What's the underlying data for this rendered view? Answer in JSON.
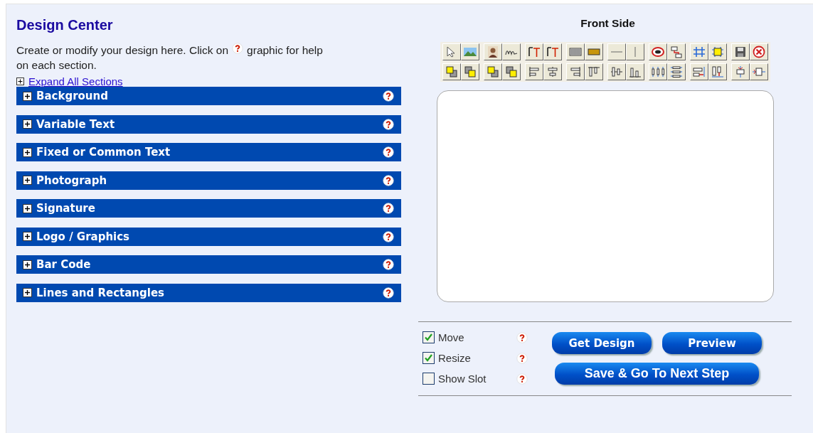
{
  "header": {
    "title": "Design Center",
    "intro_before": "Create or modify your design here. Click on",
    "intro_after": "graphic for help",
    "intro_line2": "on each section.",
    "expand_all": "Expand All Sections"
  },
  "sections": [
    {
      "label": "Background",
      "expanded": false
    },
    {
      "label": "Variable Text",
      "expanded": false
    },
    {
      "label": "Fixed or Common Text",
      "expanded": false
    },
    {
      "label": "Photograph",
      "expanded": false
    },
    {
      "label": "Signature",
      "expanded": false
    },
    {
      "label": "Logo / Graphics",
      "expanded": false
    },
    {
      "label": "Bar Code",
      "expanded": false
    },
    {
      "label": "Lines and Rectangles",
      "expanded": false
    }
  ],
  "preview": {
    "title": "Front Side"
  },
  "options": [
    {
      "label": "Move",
      "checked": true
    },
    {
      "label": "Resize",
      "checked": true
    },
    {
      "label": "Show Slot",
      "checked": false
    }
  ],
  "buttons": [
    {
      "label": "Get Design",
      "kind": "small"
    },
    {
      "label": "Preview",
      "kind": "small"
    },
    {
      "label": "Save & Go To Next Step",
      "kind": "wide"
    }
  ]
}
